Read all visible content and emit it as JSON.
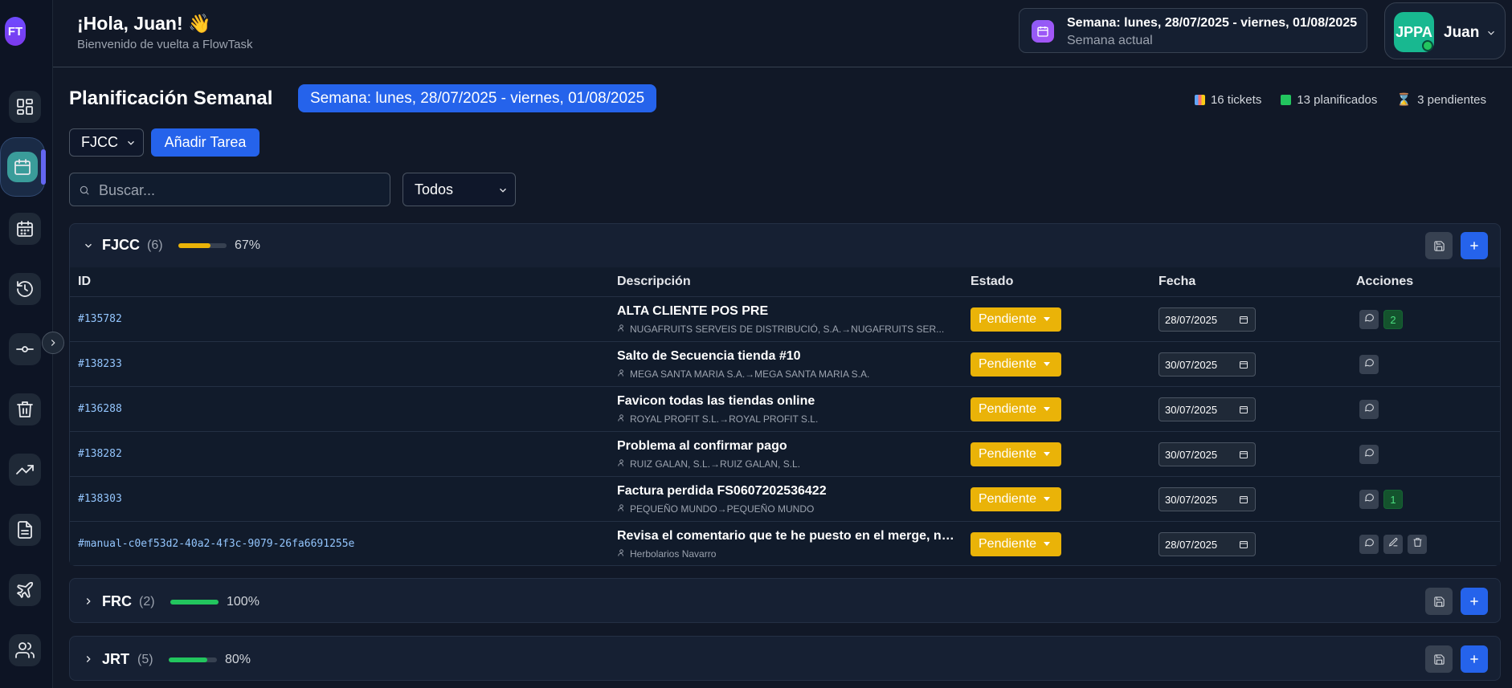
{
  "sidebar": {
    "logo": "FT",
    "items": [
      {
        "icon": "dashboard-icon"
      },
      {
        "icon": "calendar-check-icon",
        "active": true
      },
      {
        "icon": "calendar-icon"
      },
      {
        "icon": "history-icon"
      },
      {
        "icon": "commit-icon"
      },
      {
        "icon": "trash-icon"
      },
      {
        "icon": "trending-up-icon"
      },
      {
        "icon": "document-icon"
      },
      {
        "icon": "plane-icon"
      },
      {
        "icon": "users-icon"
      }
    ]
  },
  "header": {
    "greeting": "¡Hola, Juan! 👋",
    "subtitle": "Bienvenido de vuelta a FlowTask",
    "week_title": "Semana: lunes, 28/07/2025 - viernes, 01/08/2025",
    "week_sub": "Semana actual",
    "user_initials": "JPPA",
    "user_name": "Juan"
  },
  "page": {
    "title": "Planificación Semanal",
    "week_pill": "Semana: lunes, 28/07/2025 - viernes, 01/08/2025",
    "stats": {
      "tickets": "16 tickets",
      "planned": "13 planificados",
      "pending": "3 pendientes"
    },
    "team_select": "FJCC",
    "add_task": "Añadir Tarea",
    "search_placeholder": "Buscar...",
    "filter_select": "Todos"
  },
  "table_headers": {
    "id": "ID",
    "description": "Descripción",
    "status": "Estado",
    "date": "Fecha",
    "actions": "Acciones"
  },
  "groups": [
    {
      "name": "FJCC",
      "count": "(6)",
      "progress": 0.67,
      "percent": "67%",
      "bar_color": "#eab308",
      "expanded": true,
      "rows": [
        {
          "id": "#135782",
          "title": "ALTA CLIENTE POS PRE",
          "client": "NUGAFRUITS SERVEIS DE DISTRIBUCIÓ, S.A.→NUGAFRUITS SER...",
          "status": "Pendiente",
          "date": "28/07/2025",
          "comments": "2",
          "editable": false
        },
        {
          "id": "#138233",
          "title": "Salto de Secuencia tienda #10",
          "client": "MEGA SANTA MARIA S.A.→MEGA SANTA MARIA S.A.",
          "status": "Pendiente",
          "date": "30/07/2025",
          "comments": "",
          "editable": false
        },
        {
          "id": "#136288",
          "title": "Favicon todas las tiendas online",
          "client": "ROYAL PROFIT S.L.→ROYAL PROFIT S.L.",
          "status": "Pendiente",
          "date": "30/07/2025",
          "comments": "",
          "editable": false
        },
        {
          "id": "#138282",
          "title": "Problema al confirmar pago",
          "client": "RUIZ GALAN, S.L.→RUIZ GALAN, S.L.",
          "status": "Pendiente",
          "date": "30/07/2025",
          "comments": "",
          "editable": false
        },
        {
          "id": "#138303",
          "title": "Factura perdida FS0607202536422",
          "client": "PEQUEÑO MUNDO→PEQUEÑO MUNDO",
          "status": "Pendiente",
          "date": "30/07/2025",
          "comments": "1",
          "editable": false
        },
        {
          "id": "#manual-c0ef53d2-40a2-4f3c-9079-26fa6691255e",
          "title": "Revisa el comentario que te he puesto en el merge, ni he...",
          "client": "Herbolarios Navarro",
          "status": "Pendiente",
          "date": "28/07/2025",
          "comments": "",
          "editable": true
        }
      ]
    },
    {
      "name": "FRC",
      "count": "(2)",
      "progress": 1.0,
      "percent": "100%",
      "bar_color": "#22c55e",
      "expanded": false
    },
    {
      "name": "JRT",
      "count": "(5)",
      "progress": 0.8,
      "percent": "80%",
      "bar_color": "#22c55e",
      "expanded": false
    }
  ]
}
